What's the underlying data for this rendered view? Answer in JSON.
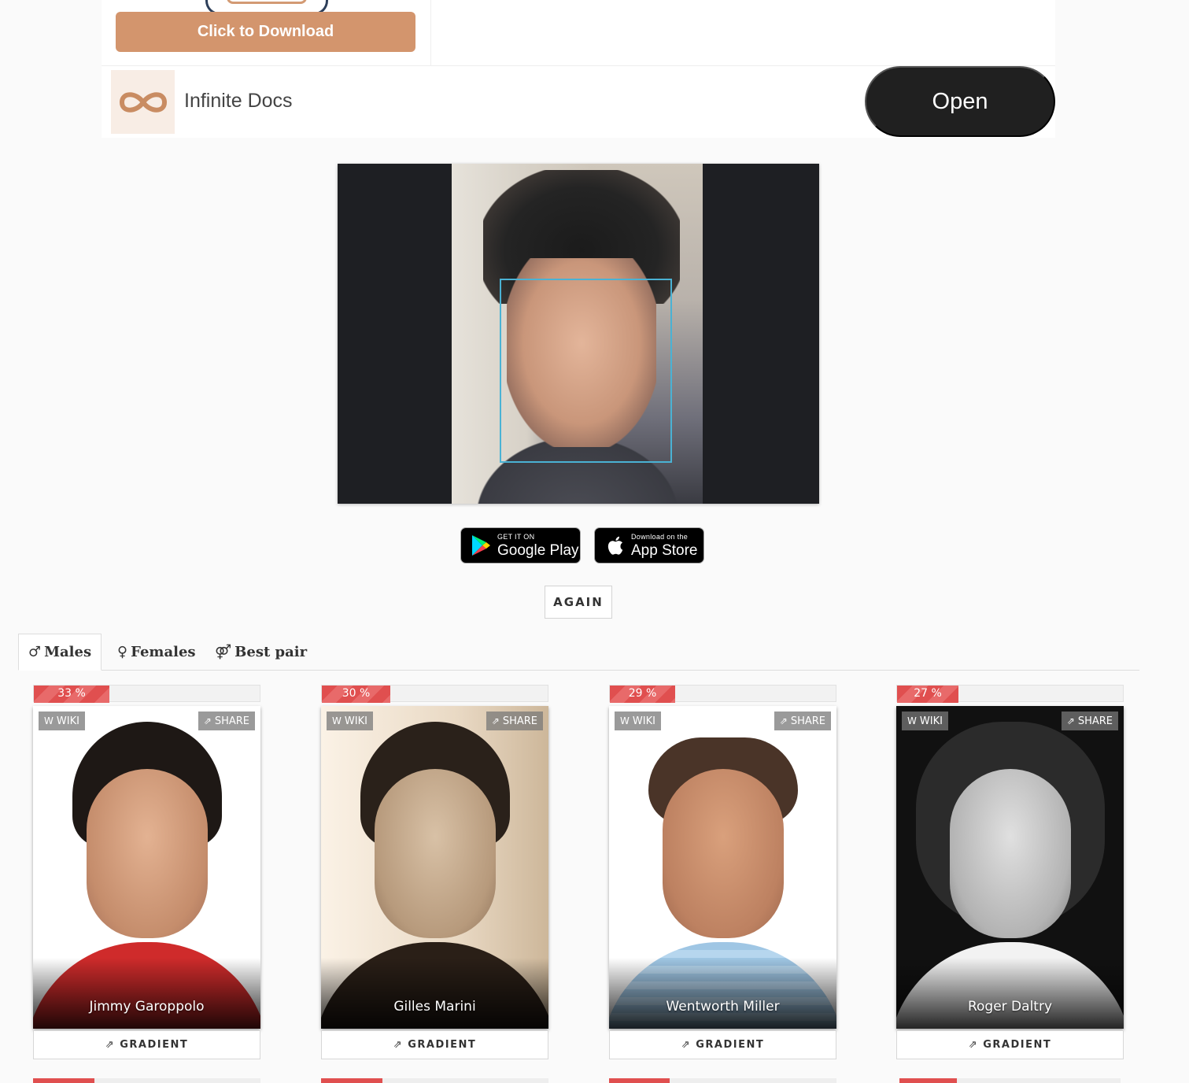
{
  "ad": {
    "cta_label": "Click to Download",
    "app_name": "Infinite Docs",
    "open_label": "Open",
    "logo_icon": "infinity-icon",
    "brand_color": "#d3956d"
  },
  "upload": {
    "photo_icon": "uploaded-face-photo",
    "face_box_color": "#4ab2d4"
  },
  "stores": {
    "google_small": "GET IT ON",
    "google_big": "Google Play",
    "apple_small": "Download on the",
    "apple_big": "App Store"
  },
  "again_label": "AGAIN",
  "tabs": [
    {
      "icon": "♂",
      "label": "Males",
      "active": true
    },
    {
      "icon": "♀",
      "label": "Females",
      "active": false
    },
    {
      "icon": "⚤",
      "label": "Best pair",
      "active": false
    }
  ],
  "card_labels": {
    "wiki": "WIKI",
    "share": "SHARE",
    "gradient": "GRADIENT"
  },
  "matches": [
    {
      "name": "Jimmy Garoppolo",
      "percent_label": "33 %",
      "percent": 33
    },
    {
      "name": "Gilles Marini",
      "percent_label": "30 %",
      "percent": 30
    },
    {
      "name": "Wentworth Miller",
      "percent_label": "29 %",
      "percent": 29
    },
    {
      "name": "Roger Daltry",
      "percent_label": "27 %",
      "percent": 27
    }
  ],
  "colors": {
    "match_bar": "#e04f4f",
    "accent_dark": "#202020"
  }
}
